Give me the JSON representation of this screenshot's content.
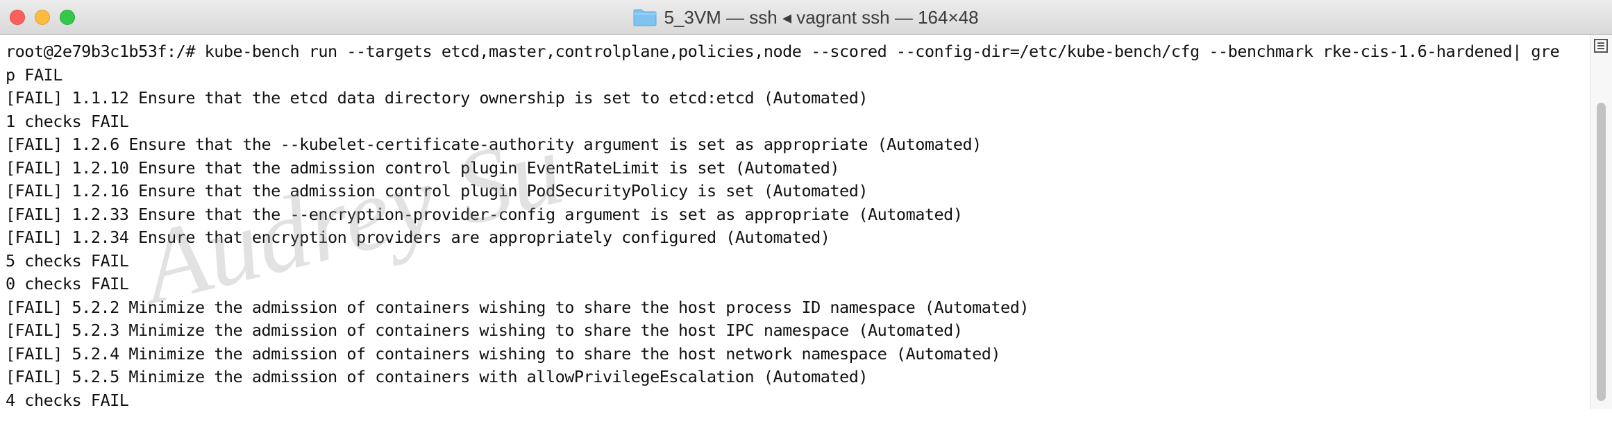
{
  "window": {
    "title": "5_3VM — ssh ◂ vagrant ssh — 164×48",
    "title_icon": "folder-icon",
    "buttons": [
      "close",
      "minimize",
      "maximize"
    ]
  },
  "terminal": {
    "lines": [
      "root@2e79b3c1b53f:/# kube-bench run --targets etcd,master,controlplane,policies,node --scored --config-dir=/etc/kube-bench/cfg --benchmark rke-cis-1.6-hardened| gre",
      "p FAIL",
      "[FAIL] 1.1.12 Ensure that the etcd data directory ownership is set to etcd:etcd (Automated)",
      "1 checks FAIL",
      "[FAIL] 1.2.6 Ensure that the --kubelet-certificate-authority argument is set as appropriate (Automated)",
      "[FAIL] 1.2.10 Ensure that the admission control plugin EventRateLimit is set (Automated)",
      "[FAIL] 1.2.16 Ensure that the admission control plugin PodSecurityPolicy is set (Automated)",
      "[FAIL] 1.2.33 Ensure that the --encryption-provider-config argument is set as appropriate (Automated)",
      "[FAIL] 1.2.34 Ensure that encryption providers are appropriately configured (Automated)",
      "5 checks FAIL",
      "0 checks FAIL",
      "[FAIL] 5.2.2 Minimize the admission of containers wishing to share the host process ID namespace (Automated)",
      "[FAIL] 5.2.3 Minimize the admission of containers wishing to share the host IPC namespace (Automated)",
      "[FAIL] 5.2.4 Minimize the admission of containers wishing to share the host network namespace (Automated)",
      "[FAIL] 5.2.5 Minimize the admission of containers with allowPrivilegeEscalation (Automated)",
      "4 checks FAIL"
    ]
  },
  "watermark": {
    "text": "Audrey Su"
  },
  "colors": {
    "close": "#fc605b",
    "minimize": "#fdbc40",
    "maximize": "#34c84a",
    "text": "#111111",
    "background": "#ffffff"
  }
}
